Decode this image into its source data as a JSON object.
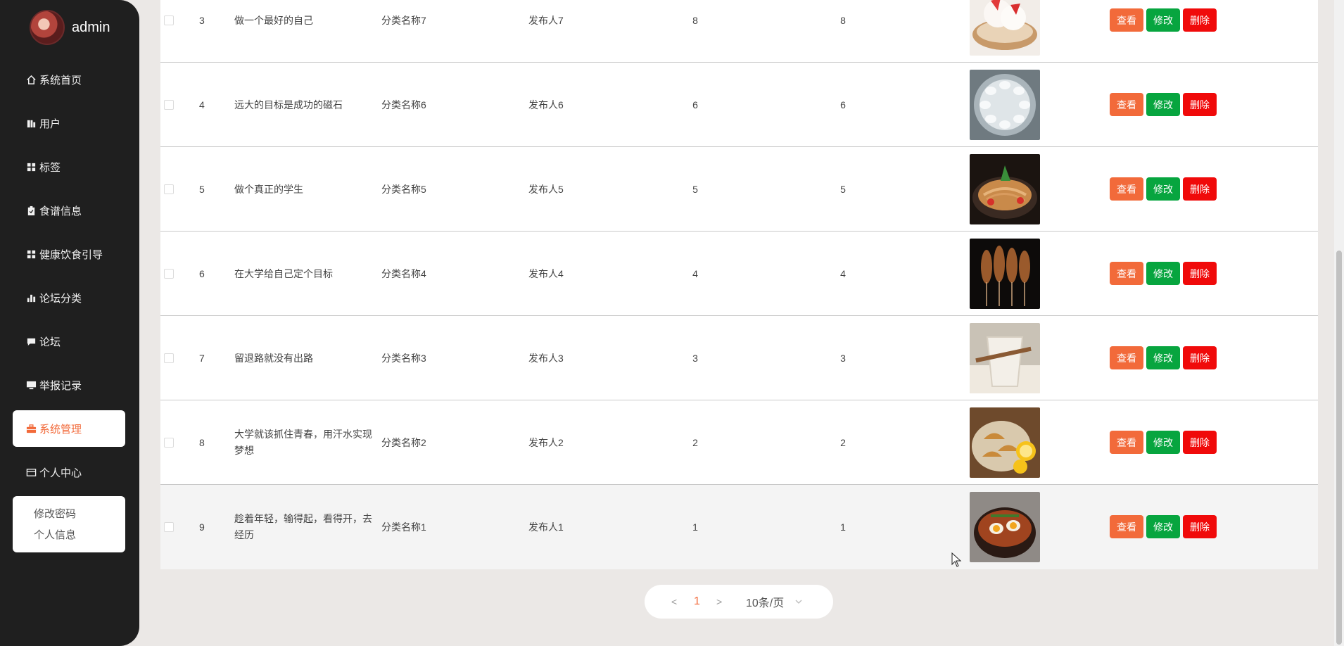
{
  "sidebar": {
    "username": "admin",
    "items": [
      {
        "label": "系统首页",
        "icon": "home-icon",
        "active": false
      },
      {
        "label": "用户",
        "icon": "users-icon",
        "active": false
      },
      {
        "label": "标签",
        "icon": "grid-icon",
        "active": false
      },
      {
        "label": "食谱信息",
        "icon": "clipboard-icon",
        "active": false
      },
      {
        "label": "健康饮食引导",
        "icon": "grid-icon",
        "active": false
      },
      {
        "label": "论坛分类",
        "icon": "bar-chart-icon",
        "active": false
      },
      {
        "label": "论坛",
        "icon": "comment-icon",
        "active": false
      },
      {
        "label": "举报记录",
        "icon": "monitor-icon",
        "active": false
      },
      {
        "label": "系统管理",
        "icon": "briefcase-icon",
        "active": true
      },
      {
        "label": "个人中心",
        "icon": "card-icon",
        "active": false
      }
    ],
    "submenu": [
      "修改密码",
      "个人信息"
    ]
  },
  "table": {
    "rows": [
      {
        "id": "3",
        "title": "做一个最好的自己",
        "category": "分类名称7",
        "publisher": "发布人7",
        "n1": "8",
        "n2": "8",
        "image": "strawberry-dessert"
      },
      {
        "id": "4",
        "title": "远大的目标是成功的磁石",
        "category": "分类名称6",
        "publisher": "发布人6",
        "n1": "6",
        "n2": "6",
        "image": "dumplings-plate"
      },
      {
        "id": "5",
        "title": "做个真正的学生",
        "category": "分类名称5",
        "publisher": "发布人5",
        "n1": "5",
        "n2": "5",
        "image": "noodle-dish"
      },
      {
        "id": "6",
        "title": "在大学给自己定个目标",
        "category": "分类名称4",
        "publisher": "发布人4",
        "n1": "4",
        "n2": "4",
        "image": "grilled-squid"
      },
      {
        "id": "7",
        "title": "留退路就没有出路",
        "category": "分类名称3",
        "publisher": "发布人3",
        "n1": "3",
        "n2": "3",
        "image": "drink"
      },
      {
        "id": "8",
        "title": "大学就该抓住青春，用汗水实现梦想",
        "category": "分类名称2",
        "publisher": "发布人2",
        "n1": "2",
        "n2": "2",
        "image": "fried-dumplings"
      },
      {
        "id": "9",
        "title": "趁着年轻，输得起，看得开，去经历",
        "category": "分类名称1",
        "publisher": "发布人1",
        "n1": "1",
        "n2": "1",
        "image": "ramen-bowl"
      }
    ],
    "actions": {
      "view": "查看",
      "edit": "修改",
      "delete": "删除"
    }
  },
  "pagination": {
    "prev": "<",
    "current_page": "1",
    "next": ">",
    "page_size": "10条/页"
  },
  "colors": {
    "accent": "#f26a3a",
    "edit": "#07a53f",
    "delete": "#f00a0a",
    "sidebar_bg": "#1f1f1f"
  }
}
